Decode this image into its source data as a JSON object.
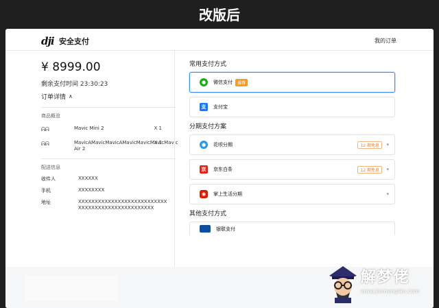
{
  "caption": "改版后",
  "header": {
    "logo": "dji",
    "title": "安全支付",
    "my_orders": "我的订单"
  },
  "order": {
    "amount": "¥ 8999.00",
    "remaining": "剩余支付时间 23:30:23",
    "details_label": "订单详情",
    "products_label": "商品概览",
    "products": [
      {
        "name": "Mavic Mini 2",
        "qty": "X 1"
      },
      {
        "name": "MavicAMavicMavicAMavicMavicMavicMavic Air 2",
        "qty": "X 1"
      }
    ],
    "shipping_label": "配送信息",
    "shipping": [
      {
        "key": "收件人",
        "value": "XXXXXX"
      },
      {
        "key": "手机",
        "value": "XXXXXXXX"
      },
      {
        "key": "地址",
        "value": "XXXXXXXXXXXXXXXXXXXXXXXXXXXXXXXXXXXXXXXXXXXXXXXXXX"
      }
    ]
  },
  "payment": {
    "common_title": "常用支付方式",
    "common": [
      {
        "label": "微信支付",
        "badge": "推荐",
        "icon": "wechat-icon",
        "selected": true
      },
      {
        "label": "支付宝",
        "icon": "alipay-icon"
      }
    ],
    "installment_title": "分期支付方案",
    "installment": [
      {
        "label": "花呗分期",
        "tag": "12 期免息",
        "icon": "huabei-icon"
      },
      {
        "label": "京东白条",
        "tag": "12 期免息",
        "icon": "jd-icon"
      },
      {
        "label": "掌上生活分期",
        "icon": "cmb-life-icon"
      }
    ],
    "other_title": "其他支付方式",
    "other": [
      {
        "label": "银联支付",
        "icon": "unionpay-icon"
      }
    ]
  },
  "watermark": {
    "text": "解梦佬",
    "url": "www.jiemenglao.com"
  }
}
